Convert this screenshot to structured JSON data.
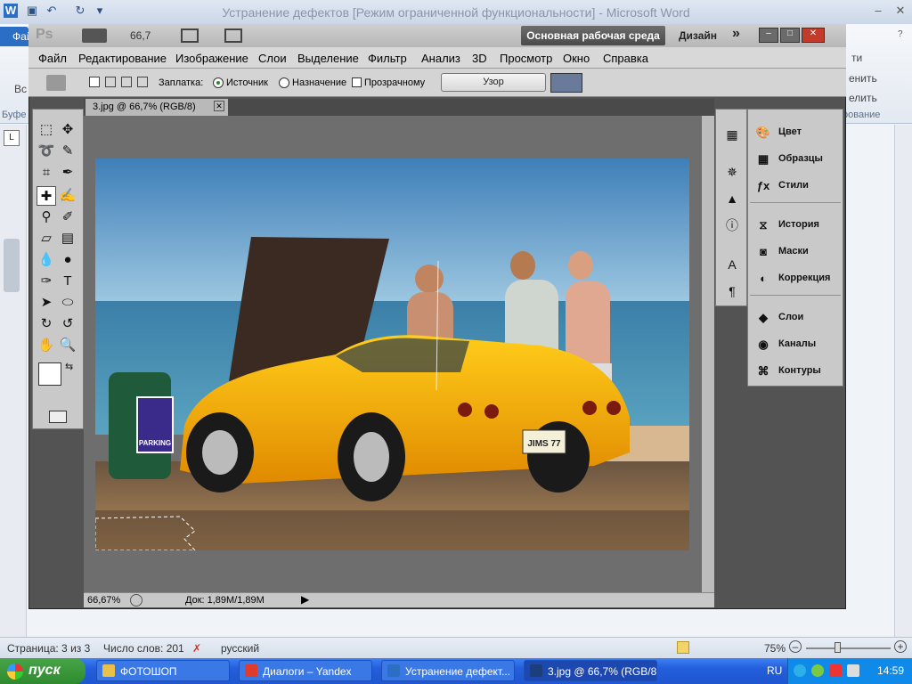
{
  "word": {
    "title": "Устранение дефектов [Режим ограниченной функциональности]  -  Microsoft Word",
    "file_tab": "Фай",
    "ribbon_left": "Вс",
    "ribbon_left2": "Буфе",
    "ribbon_right1": "ти",
    "ribbon_right2": "енить",
    "ribbon_right3": "елить",
    "ribbon_right4": "рование",
    "status": {
      "page": "Страница: 3 из 3",
      "words": "Число слов: 201",
      "lang": "русский",
      "zoom": "75%"
    }
  },
  "ps": {
    "logo": "Ps",
    "zoom_display": "66,7",
    "workspace": "Основная рабочая среда",
    "design": "Дизайн",
    "more": "»",
    "menus": [
      "Файл",
      "Редактирование",
      "Изображение",
      "Слои",
      "Выделение",
      "Фильтр",
      "Анализ",
      "3D",
      "Просмотр",
      "Окно",
      "Справка"
    ],
    "options": {
      "patch_label": "Заплатка:",
      "source": "Источник",
      "dest": "Назначение",
      "transparent": "Прозрачному",
      "pattern_btn": "Узор"
    },
    "doc_tab": "3.jpg @ 66,7% (RGB/8)",
    "doc_status": {
      "zoom": "66,67%",
      "doc": "Док: 1,89M/1,89M"
    },
    "panels": [
      {
        "label": "Цвет",
        "icon": "palette-icon"
      },
      {
        "label": "Образцы",
        "icon": "swatches-icon"
      },
      {
        "label": "Стили",
        "icon": "styles-fx-icon"
      },
      {
        "label": "История",
        "icon": "history-icon"
      },
      {
        "label": "Маски",
        "icon": "masks-icon"
      },
      {
        "label": "Коррекция",
        "icon": "adjustments-icon"
      },
      {
        "label": "Слои",
        "icon": "layers-icon"
      },
      {
        "label": "Каналы",
        "icon": "channels-icon"
      },
      {
        "label": "Контуры",
        "icon": "paths-icon"
      }
    ],
    "photo": {
      "plate": "JIMS 77",
      "sign": "PARKING"
    }
  },
  "taskbar": {
    "start": "пуск",
    "items": [
      {
        "label": "ФОТОШОП",
        "color": "#e8c04a"
      },
      {
        "label": "Диалоги – Yandex",
        "color": "#e03b2b"
      },
      {
        "label": "Устранение дефект...",
        "color": "#2a6fc5"
      },
      {
        "label": "3.jpg @ 66,7% (RGB/8)",
        "color": "#1a3f7a"
      }
    ],
    "lang": "RU",
    "time": "14:59"
  }
}
